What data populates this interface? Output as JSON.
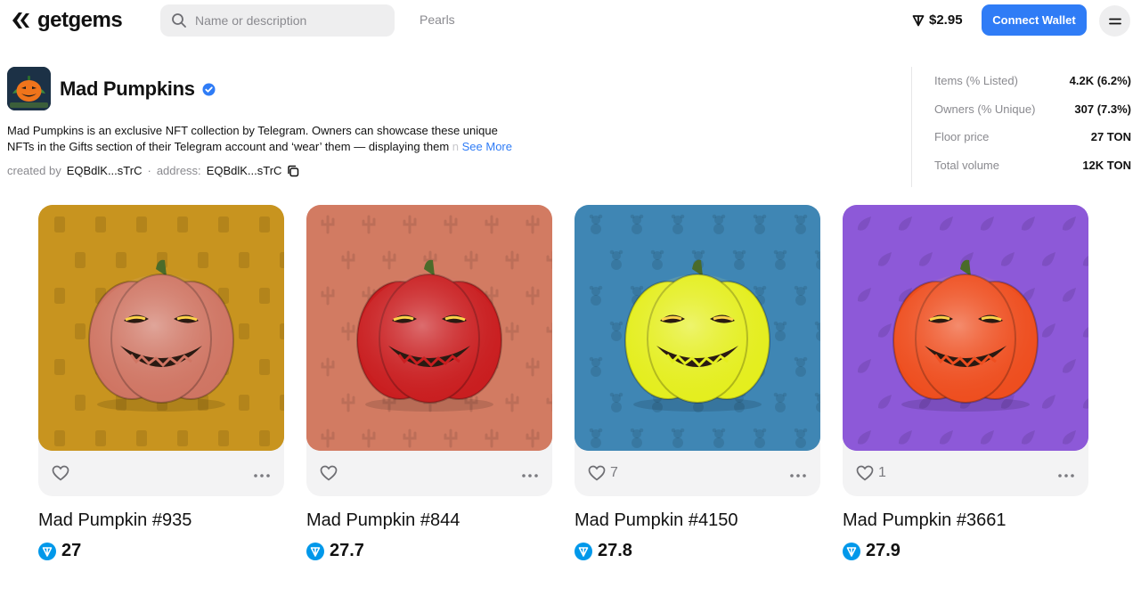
{
  "header": {
    "logo_text": "getgems",
    "search_placeholder": "Name or description",
    "nav_pearls": "Pearls",
    "ton_price": "$2.95",
    "connect_wallet": "Connect Wallet"
  },
  "collection": {
    "title": "Mad Pumpkins",
    "description_line1": "Mad Pumpkins is an exclusive NFT collection by Telegram. Owners can showcase these unique",
    "description_line2": "NFTs in the Gifts section of their Telegram account and ‘wear’ them — displaying them ",
    "description_fade": "n",
    "see_more": "See More",
    "created_by_label": "created by",
    "created_by_value": "EQBdlK...sTrC",
    "separator": "·",
    "address_label": "address:",
    "address_value": "EQBdlK...sTrC"
  },
  "stats": [
    {
      "label": "Items (% Listed)",
      "value": "4.2K (6.2%)"
    },
    {
      "label": "Owners (% Unique)",
      "value": "307 (7.3%)"
    },
    {
      "label": "Floor price",
      "value": "27 TON"
    },
    {
      "label": "Total volume",
      "value": "12K TON"
    }
  ],
  "cards": [
    {
      "name": "Mad Pumpkin #935",
      "price": "27",
      "likes": "",
      "bg": "#c8941f",
      "pumpkin": "#cf7563",
      "pattern": "phone"
    },
    {
      "name": "Mad Pumpkin #844",
      "price": "27.7",
      "likes": "",
      "bg": "#d27b62",
      "pumpkin": "#c91e20",
      "pattern": "cactus"
    },
    {
      "name": "Mad Pumpkin #4150",
      "price": "27.8",
      "likes": "7",
      "bg": "#3f86b4",
      "pumpkin": "#e4ee1e",
      "pattern": "bear"
    },
    {
      "name": "Mad Pumpkin #3661",
      "price": "27.9",
      "likes": "1",
      "bg": "#8d59d8",
      "pumpkin": "#ee4e1f",
      "pattern": "drop"
    }
  ],
  "colors": {
    "accent": "#2f7cf6",
    "verified": "#2f7cf6",
    "ton": "#0098ea"
  }
}
